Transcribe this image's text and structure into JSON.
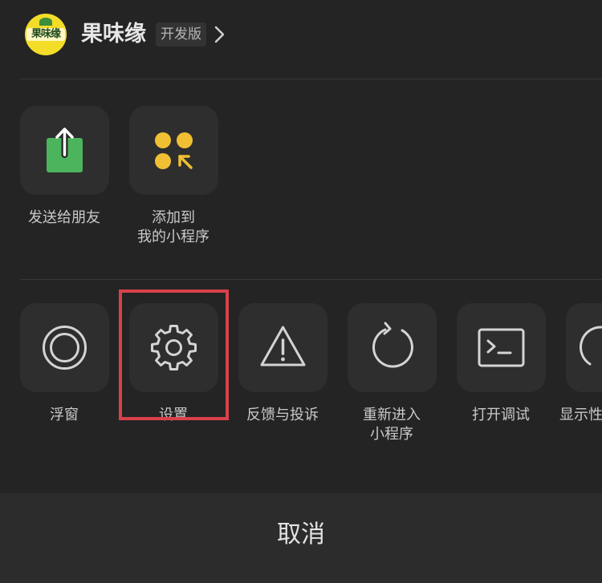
{
  "header": {
    "app_name": "果味缘",
    "version_badge": "开发版",
    "logo_text": "果味缘"
  },
  "share_actions": [
    {
      "label": "发送给朋友",
      "icon": "share-upload-icon"
    },
    {
      "label": "添加到\n我的小程序",
      "icon": "add-to-my-miniprogram-icon"
    }
  ],
  "tool_actions": [
    {
      "label": "浮窗",
      "icon": "floating-window-icon"
    },
    {
      "label": "设置",
      "icon": "gear-icon"
    },
    {
      "label": "反馈与投诉",
      "icon": "warning-triangle-icon"
    },
    {
      "label": "重新进入\n小程序",
      "icon": "reload-icon"
    },
    {
      "label": "打开调试",
      "icon": "terminal-icon"
    },
    {
      "label": "显示性",
      "icon": "performance-gauge-icon"
    }
  ],
  "cancel_label": "取消",
  "colors": {
    "background": "#242424",
    "tile": "#2e2e2e",
    "share_green": "#4cb45c",
    "accent_yellow": "#f0bf33",
    "highlight_red": "#d9414a",
    "icon_gray": "#d4d4d4"
  }
}
